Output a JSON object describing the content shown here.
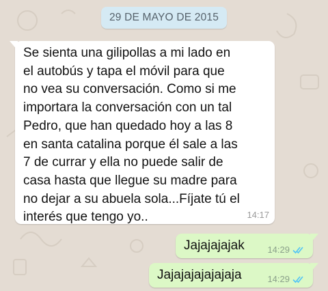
{
  "chat": {
    "date_label": "29 DE MAYO DE 2015",
    "messages": [
      {
        "direction": "incoming",
        "text": "Se sienta una gilipollas a mi lado en\nel autobús  y tapa el móvil para que\nno vea su conversación. Como si me\nimportara la conversación con un tal\nPedro, que han quedado hoy a las 8\nen santa catalina porque él sale a las\n7 de currar y ella no puede salir de\ncasa hasta que llegue su madre para\nno dejar a su abuela sola...Fíjate tú el\ninterés que tengo yo..",
        "time": "14:17"
      },
      {
        "direction": "outgoing",
        "text": "Jajajajajak",
        "time": "14:29",
        "status_icon": "double-check-read-icon"
      },
      {
        "direction": "outgoing",
        "text": "Jajajajajajajaja",
        "time": "14:29",
        "status_icon": "double-check-read-icon"
      }
    ]
  },
  "colors": {
    "wallpaper": "#e4dcd3",
    "date_pill": "#d5eaf4",
    "incoming_bubble": "#ffffff",
    "outgoing_bubble": "#dcf8c6",
    "read_ticks": "#4fc3f7"
  }
}
